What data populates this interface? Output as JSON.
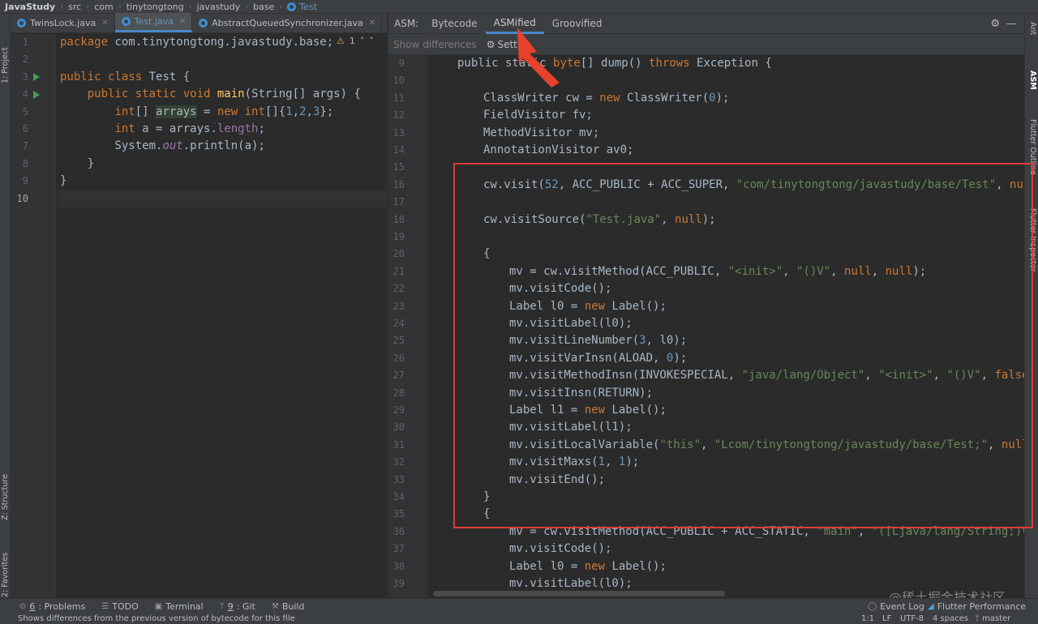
{
  "breadcrumbs": [
    "JavaStudy",
    "src",
    "com",
    "tinytongtong",
    "javastudy",
    "base",
    "Test"
  ],
  "editor_tabs": [
    {
      "label": "TwinsLock.java"
    },
    {
      "label": "Test.java"
    },
    {
      "label": "AbstractQueuedSynchronizer.java"
    }
  ],
  "warning_count": "1",
  "left_strip": {
    "project": "1: Project",
    "structure": "Z: Structure",
    "favorites": "2: Favorites"
  },
  "right_strip": {
    "ant": "Ant",
    "asm": "ASM",
    "flutter_outline": "Flutter Outline",
    "flutter_inspector": "Flutter Inspector"
  },
  "asm_panel": {
    "label": "ASM:",
    "tabs": [
      "Bytecode",
      "ASMified",
      "Groovified"
    ],
    "show_differences": "Show differences",
    "settings": "Settin"
  },
  "left_code_line_numbers": [
    "1",
    "2",
    "3",
    "4",
    "5",
    "6",
    "7",
    "8",
    "9",
    "10"
  ],
  "right_code_line_numbers": [
    "9",
    "10",
    "11",
    "12",
    "13",
    "14",
    "15",
    "16",
    "17",
    "18",
    "19",
    "20",
    "21",
    "22",
    "23",
    "24",
    "25",
    "26",
    "27",
    "28",
    "29",
    "30",
    "31",
    "32",
    "33",
    "34",
    "35",
    "36",
    "37",
    "38",
    "39"
  ],
  "bottom_tools": [
    {
      "key": "6",
      "label": ": Problems"
    },
    {
      "key": "",
      "label": "TODO"
    },
    {
      "key": "",
      "label": "Terminal"
    },
    {
      "key": "9",
      "label": ": Git"
    },
    {
      "key": "",
      "label": "Build"
    }
  ],
  "bottom_right_tools": [
    "Event Log",
    "Flutter Performance"
  ],
  "status": {
    "message": "Shows differences from the previous version of bytecode for this file",
    "position": "1:1",
    "line_sep": "LF",
    "encoding": "UTF-8",
    "indent": "4 spaces",
    "branch": "master"
  },
  "watermark": "@稀土掘金技术社区",
  "colors": {
    "keyword": "#cc7832",
    "number": "#6897bb",
    "string": "#6a8759",
    "field": "#9876aa",
    "function": "#ffc66d",
    "highlight_box": "#e03a3a",
    "accent": "#4a88c7"
  }
}
